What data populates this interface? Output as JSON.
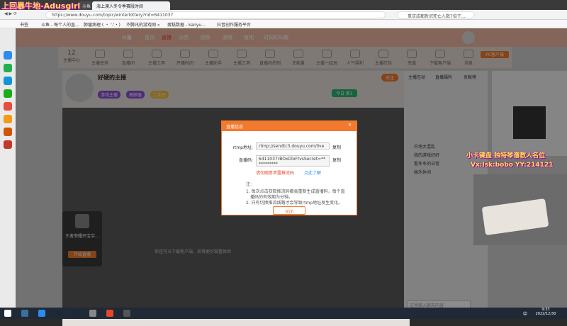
{
  "overlay": {
    "logo_text": "上回暴牛地-Adusgirl",
    "sub_line1": "小卡键盘 独特琴谱教人名位",
    "sub_line2": "Vx:Isk:bobo YY:214121"
  },
  "browser": {
    "tabs": [
      "斗鱼 - 每个人的直播平台",
      "海上漠人冬令季赛段时间"
    ],
    "url": "https://www.douyu.com/topic/winterlottery?rid=6411037",
    "search_placeholder": "重庆成都新冠死亡人数7倍于..."
  },
  "bookmarks": [
    "书签",
    "斗鱼 - 每个人的直…",
    "肿瘤病理 ( ・ '-'・)",
    "不腾讯的游戏网 »",
    "蛋糕数据 - kanyu...",
    "抖音创作服务平台"
  ],
  "site": {
    "logo": "斗鱼",
    "nav": [
      "首页",
      "直播",
      "分类",
      "视频",
      "游戏",
      "鱼吧",
      "时刻的乐趣"
    ],
    "categories": [
      {
        "label": "12",
        "sub": "主播中心"
      },
      {
        "label": "主播任务"
      },
      {
        "label": "直播间"
      },
      {
        "label": "主播工具"
      },
      {
        "label": "开播时间"
      },
      {
        "label": "主播助手"
      },
      {
        "label": "主播工具"
      },
      {
        "label": "直播间控制"
      },
      {
        "label": "正能量"
      },
      {
        "label": "主播一起玩"
      },
      {
        "label": "人气福利"
      },
      {
        "label": "主播红包"
      },
      {
        "label": "充值"
      },
      {
        "label": "下载客户端"
      },
      {
        "label": "消息"
      }
    ],
    "pc_client_label": "PC客户端"
  },
  "room": {
    "streamer_name": "好硬的主播",
    "tags": [
      "游戏主播",
      "高颜值",
      "二次元"
    ],
    "follow_label": "关注",
    "rank_badge": "今日 第1",
    "hint_text": "你还可以下载客户端，获得更好观看体验"
  },
  "side_card": {
    "name": "王者荣耀开宝宇...",
    "button": "开始直播"
  },
  "right_panel": {
    "tabs": [
      "主播互动",
      "直播福利",
      "贡献榜"
    ],
    "items": [
      "开场大混乱",
      "我的游戏好好",
      "看冬冬的日常",
      "娱乐休闲"
    ],
    "chat_placeholder": "这里输入聊天内容"
  },
  "modal": {
    "title": "直播信息",
    "rtmp_label": "rtmp地址:",
    "rtmp_value": "rtmp://sendtc3.douyu.com/live",
    "code_label": "直播码:",
    "code_value": "6411037rBOxDloFtvsSecret=***********",
    "copy_label": "复制",
    "warning": "请勿随意泄露推流码",
    "learn_more": "点此了解",
    "notes_title": "注:",
    "note1": "1. 每次点击获取推流码都会重新生成直播码，每个直",
    "note1b": "播码的有效期为分钟。",
    "note2": "2. 只有切换推流线路才会导致rtmp地址发生变化。",
    "close_label": "关闭"
  },
  "taskbar": {
    "lang": "中",
    "time": "9:33",
    "date": "2022/12/30"
  },
  "colors": {
    "accent": "#f27a2e",
    "header": "#f0b9a3",
    "overlay_text": "#f6e04a"
  }
}
